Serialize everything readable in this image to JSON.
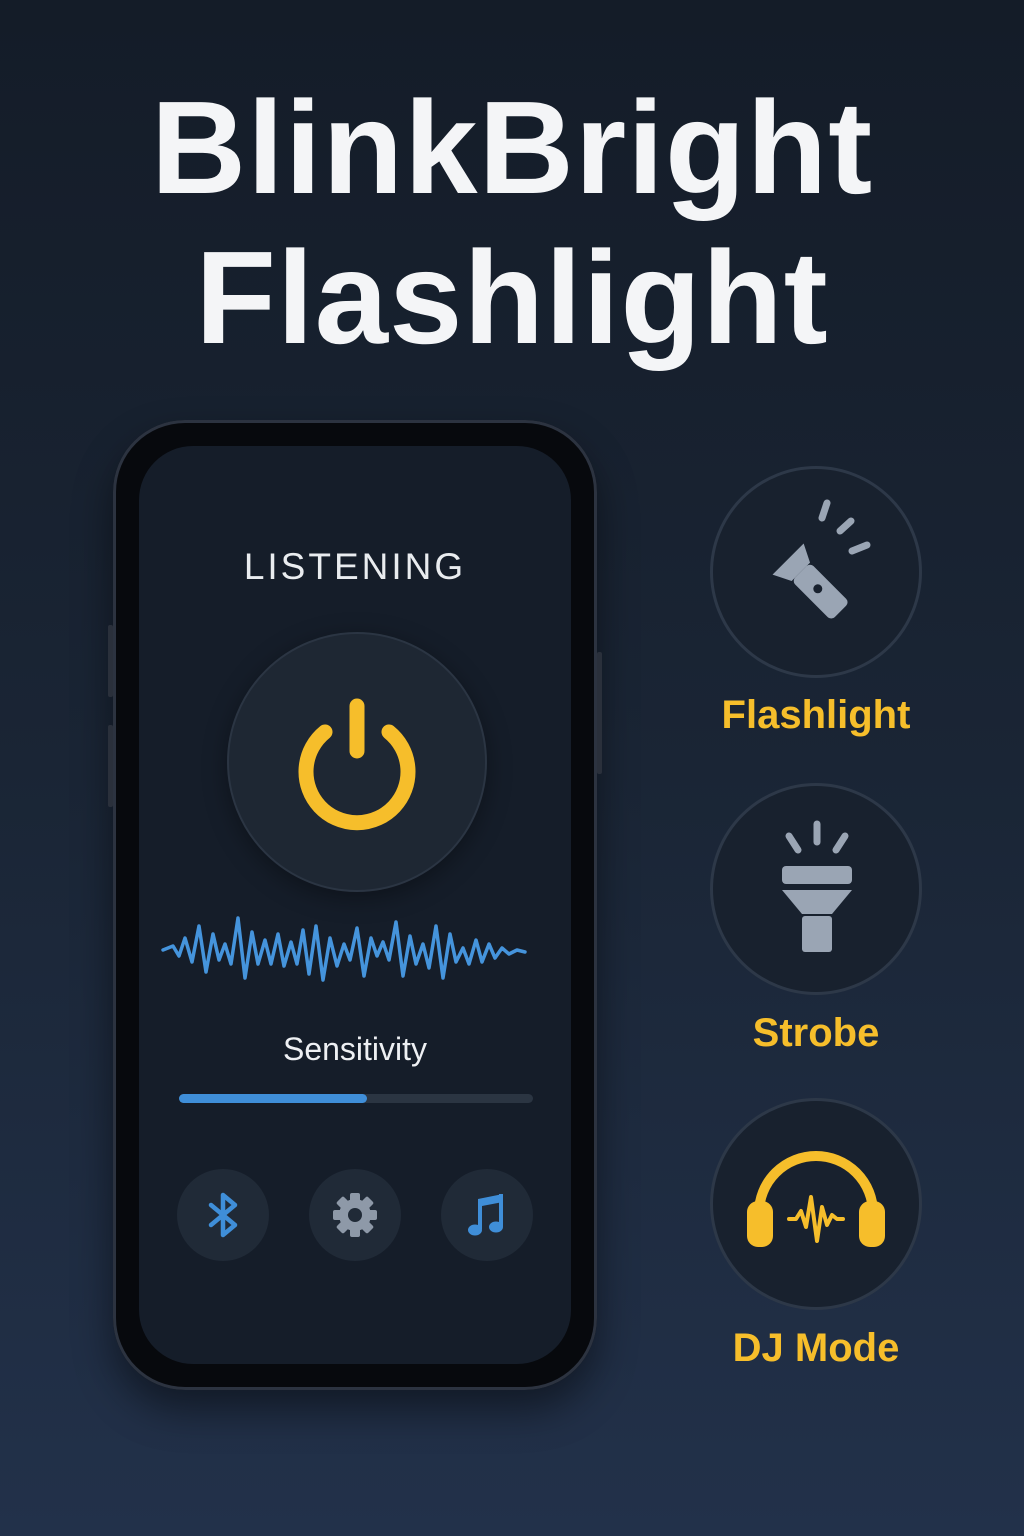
{
  "title": {
    "line1": "BlinkBright",
    "line2": "Flashlight"
  },
  "phone": {
    "status": "LISTENING",
    "power_icon": "power-icon",
    "sensitivity": {
      "label": "Sensitivity",
      "level_fraction": 0.53
    },
    "bottom_buttons": [
      {
        "icon": "bluetooth-icon"
      },
      {
        "icon": "gear-icon"
      },
      {
        "icon": "music-note-icon"
      }
    ]
  },
  "modes": [
    {
      "label": "Flashlight",
      "icon": "flashlight-icon"
    },
    {
      "label": "Strobe",
      "icon": "strobe-icon"
    },
    {
      "label": "DJ Mode",
      "icon": "headphones-icon"
    }
  ],
  "colors": {
    "accent_yellow": "#f6be2b",
    "accent_blue": "#3f8ed8",
    "icon_gray": "#9aa5b4",
    "background": "#1a2535"
  }
}
